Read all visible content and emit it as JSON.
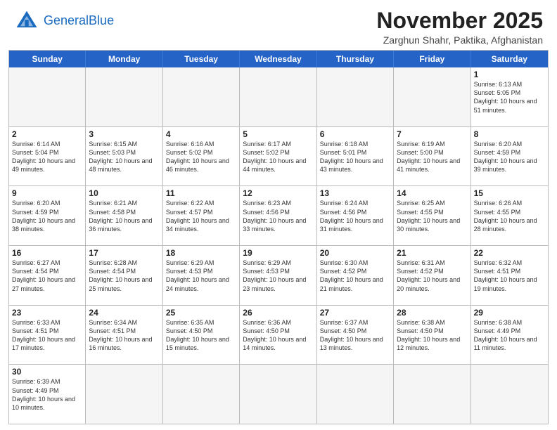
{
  "header": {
    "logo_general": "General",
    "logo_blue": "Blue",
    "month": "November 2025",
    "location": "Zarghun Shahr, Paktika, Afghanistan"
  },
  "weekdays": [
    "Sunday",
    "Monday",
    "Tuesday",
    "Wednesday",
    "Thursday",
    "Friday",
    "Saturday"
  ],
  "rows": [
    [
      {
        "day": "",
        "info": "",
        "empty": true
      },
      {
        "day": "",
        "info": "",
        "empty": true
      },
      {
        "day": "",
        "info": "",
        "empty": true
      },
      {
        "day": "",
        "info": "",
        "empty": true
      },
      {
        "day": "",
        "info": "",
        "empty": true
      },
      {
        "day": "",
        "info": "",
        "empty": true
      },
      {
        "day": "1",
        "info": "Sunrise: 6:13 AM\nSunset: 5:05 PM\nDaylight: 10 hours\nand 51 minutes.",
        "empty": false
      }
    ],
    [
      {
        "day": "2",
        "info": "Sunrise: 6:14 AM\nSunset: 5:04 PM\nDaylight: 10 hours\nand 49 minutes.",
        "empty": false
      },
      {
        "day": "3",
        "info": "Sunrise: 6:15 AM\nSunset: 5:03 PM\nDaylight: 10 hours\nand 48 minutes.",
        "empty": false
      },
      {
        "day": "4",
        "info": "Sunrise: 6:16 AM\nSunset: 5:02 PM\nDaylight: 10 hours\nand 46 minutes.",
        "empty": false
      },
      {
        "day": "5",
        "info": "Sunrise: 6:17 AM\nSunset: 5:02 PM\nDaylight: 10 hours\nand 44 minutes.",
        "empty": false
      },
      {
        "day": "6",
        "info": "Sunrise: 6:18 AM\nSunset: 5:01 PM\nDaylight: 10 hours\nand 43 minutes.",
        "empty": false
      },
      {
        "day": "7",
        "info": "Sunrise: 6:19 AM\nSunset: 5:00 PM\nDaylight: 10 hours\nand 41 minutes.",
        "empty": false
      },
      {
        "day": "8",
        "info": "Sunrise: 6:20 AM\nSunset: 4:59 PM\nDaylight: 10 hours\nand 39 minutes.",
        "empty": false
      }
    ],
    [
      {
        "day": "9",
        "info": "Sunrise: 6:20 AM\nSunset: 4:59 PM\nDaylight: 10 hours\nand 38 minutes.",
        "empty": false
      },
      {
        "day": "10",
        "info": "Sunrise: 6:21 AM\nSunset: 4:58 PM\nDaylight: 10 hours\nand 36 minutes.",
        "empty": false
      },
      {
        "day": "11",
        "info": "Sunrise: 6:22 AM\nSunset: 4:57 PM\nDaylight: 10 hours\nand 34 minutes.",
        "empty": false
      },
      {
        "day": "12",
        "info": "Sunrise: 6:23 AM\nSunset: 4:56 PM\nDaylight: 10 hours\nand 33 minutes.",
        "empty": false
      },
      {
        "day": "13",
        "info": "Sunrise: 6:24 AM\nSunset: 4:56 PM\nDaylight: 10 hours\nand 31 minutes.",
        "empty": false
      },
      {
        "day": "14",
        "info": "Sunrise: 6:25 AM\nSunset: 4:55 PM\nDaylight: 10 hours\nand 30 minutes.",
        "empty": false
      },
      {
        "day": "15",
        "info": "Sunrise: 6:26 AM\nSunset: 4:55 PM\nDaylight: 10 hours\nand 28 minutes.",
        "empty": false
      }
    ],
    [
      {
        "day": "16",
        "info": "Sunrise: 6:27 AM\nSunset: 4:54 PM\nDaylight: 10 hours\nand 27 minutes.",
        "empty": false
      },
      {
        "day": "17",
        "info": "Sunrise: 6:28 AM\nSunset: 4:54 PM\nDaylight: 10 hours\nand 25 minutes.",
        "empty": false
      },
      {
        "day": "18",
        "info": "Sunrise: 6:29 AM\nSunset: 4:53 PM\nDaylight: 10 hours\nand 24 minutes.",
        "empty": false
      },
      {
        "day": "19",
        "info": "Sunrise: 6:29 AM\nSunset: 4:53 PM\nDaylight: 10 hours\nand 23 minutes.",
        "empty": false
      },
      {
        "day": "20",
        "info": "Sunrise: 6:30 AM\nSunset: 4:52 PM\nDaylight: 10 hours\nand 21 minutes.",
        "empty": false
      },
      {
        "day": "21",
        "info": "Sunrise: 6:31 AM\nSunset: 4:52 PM\nDaylight: 10 hours\nand 20 minutes.",
        "empty": false
      },
      {
        "day": "22",
        "info": "Sunrise: 6:32 AM\nSunset: 4:51 PM\nDaylight: 10 hours\nand 19 minutes.",
        "empty": false
      }
    ],
    [
      {
        "day": "23",
        "info": "Sunrise: 6:33 AM\nSunset: 4:51 PM\nDaylight: 10 hours\nand 17 minutes.",
        "empty": false
      },
      {
        "day": "24",
        "info": "Sunrise: 6:34 AM\nSunset: 4:51 PM\nDaylight: 10 hours\nand 16 minutes.",
        "empty": false
      },
      {
        "day": "25",
        "info": "Sunrise: 6:35 AM\nSunset: 4:50 PM\nDaylight: 10 hours\nand 15 minutes.",
        "empty": false
      },
      {
        "day": "26",
        "info": "Sunrise: 6:36 AM\nSunset: 4:50 PM\nDaylight: 10 hours\nand 14 minutes.",
        "empty": false
      },
      {
        "day": "27",
        "info": "Sunrise: 6:37 AM\nSunset: 4:50 PM\nDaylight: 10 hours\nand 13 minutes.",
        "empty": false
      },
      {
        "day": "28",
        "info": "Sunrise: 6:38 AM\nSunset: 4:50 PM\nDaylight: 10 hours\nand 12 minutes.",
        "empty": false
      },
      {
        "day": "29",
        "info": "Sunrise: 6:38 AM\nSunset: 4:49 PM\nDaylight: 10 hours\nand 11 minutes.",
        "empty": false
      }
    ],
    [
      {
        "day": "30",
        "info": "Sunrise: 6:39 AM\nSunset: 4:49 PM\nDaylight: 10 hours\nand 10 minutes.",
        "empty": false
      },
      {
        "day": "",
        "info": "",
        "empty": true
      },
      {
        "day": "",
        "info": "",
        "empty": true
      },
      {
        "day": "",
        "info": "",
        "empty": true
      },
      {
        "day": "",
        "info": "",
        "empty": true
      },
      {
        "day": "",
        "info": "",
        "empty": true
      },
      {
        "day": "",
        "info": "",
        "empty": true
      }
    ]
  ]
}
